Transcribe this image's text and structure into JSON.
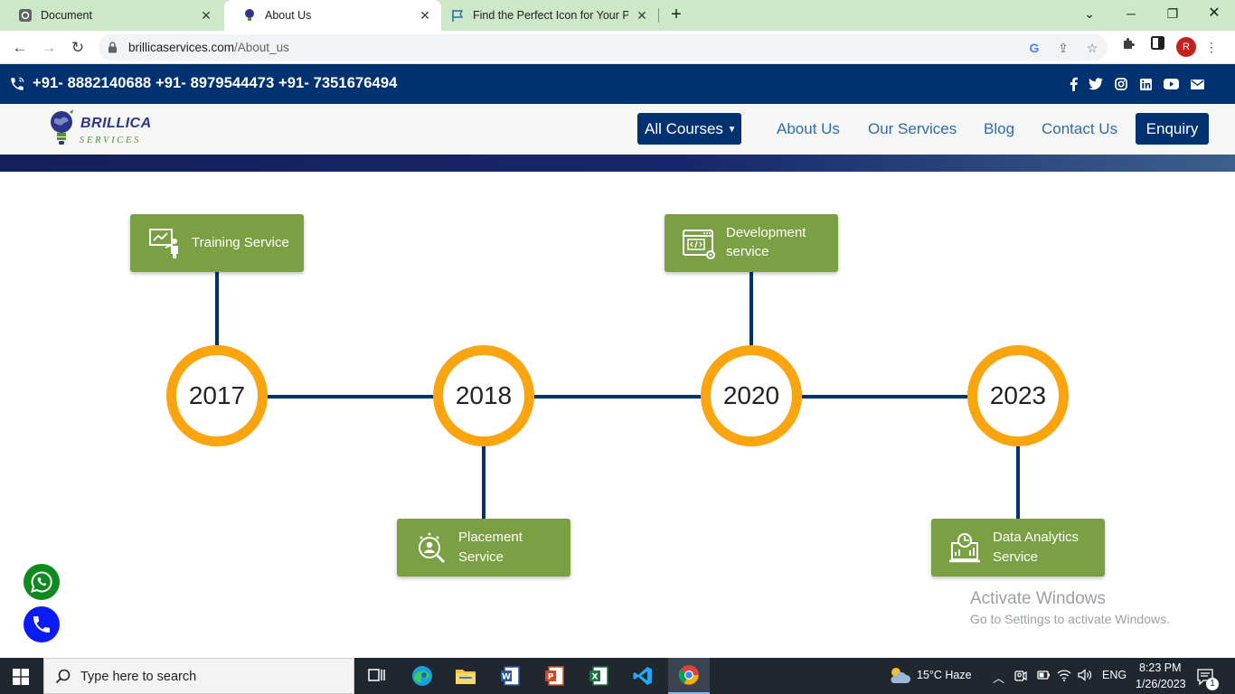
{
  "browser": {
    "tabs": [
      {
        "title": "Document",
        "active": false
      },
      {
        "title": "About Us",
        "active": true
      },
      {
        "title": "Find the Perfect Icon for Your Pro",
        "active": false
      }
    ],
    "url_host": "brillicaservices.com",
    "url_path": "/About_us",
    "profile_initial": "R"
  },
  "site": {
    "phones": "+91- 8882140688 +91- 8979544473 +91- 7351676494",
    "logo_title": "BRILLICA",
    "logo_subtitle": "SERVICES",
    "nav": {
      "courses": "All Courses",
      "about": "About Us",
      "services": "Our Services",
      "blog": "Blog",
      "contact": "Contact Us",
      "enquiry": "Enquiry"
    },
    "social_icons": [
      "facebook-icon",
      "twitter-icon",
      "instagram-icon",
      "linkedin-icon",
      "youtube-icon",
      "mail-icon"
    ]
  },
  "timeline": {
    "years": [
      "2017",
      "2018",
      "2020",
      "2023"
    ],
    "cards": [
      {
        "title_line1": "Training Service",
        "title_line2": ""
      },
      {
        "title_line1": "Placement",
        "title_line2": "Service"
      },
      {
        "title_line1": "Development",
        "title_line2": "service"
      },
      {
        "title_line1": "Data Analytics",
        "title_line2": "Service"
      }
    ]
  },
  "colors": {
    "navy": "#003272",
    "orange": "#faa50f",
    "green": "#7ba043",
    "whatsapp": "#0f8a1f",
    "call": "#0a1bf5"
  },
  "watermark": {
    "line1": "Activate Windows",
    "line2": "Go to Settings to activate Windows."
  },
  "taskbar": {
    "search_placeholder": "Type here to search",
    "weather": "15°C  Haze",
    "language": "ENG",
    "time": "8:23 PM",
    "date": "1/26/2023",
    "notification_count": "1"
  }
}
